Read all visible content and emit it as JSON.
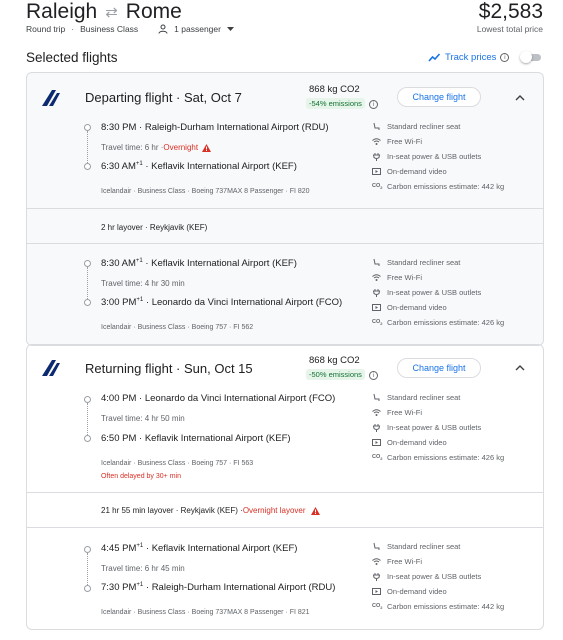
{
  "header": {
    "origin": "Raleigh",
    "destination": "Rome",
    "price": "$2,583",
    "price_sub": "Lowest total price",
    "trip_type": "Round trip",
    "cabin": "Business Class",
    "passengers": "1 passenger"
  },
  "selected_label": "Selected flights",
  "track_label": "Track prices",
  "departing": {
    "title": "Departing flight · Sat, Oct 7",
    "co2": "868 kg CO2",
    "emissions": "-54% emissions",
    "change": "Change flight",
    "leg1": {
      "dep_time": "8:30 PM",
      "dep_airport": "Raleigh-Durham International Airport (RDU)",
      "travel": "Travel time: 6 hr · ",
      "overnight": "Overnight",
      "arr_time": "6:30 AM",
      "arr_plus": "+1",
      "arr_airport": "Keflavik International Airport (KEF)",
      "details": "Icelandair · Business Class · Boeing 737MAX 8 Passenger · FI 820",
      "amenities": [
        "Standard recliner seat",
        "Free Wi-Fi",
        "In-seat power & USB outlets",
        "On-demand video",
        "Carbon emissions estimate: 442 kg"
      ]
    },
    "layover": "2 hr layover · Reykjavik (KEF)",
    "leg2": {
      "dep_time": "8:30 AM",
      "dep_plus": "+1",
      "dep_airport": "Keflavik International Airport (KEF)",
      "travel": "Travel time: 4 hr 30 min",
      "arr_time": "3:00 PM",
      "arr_plus": "+1",
      "arr_airport": "Leonardo da Vinci International Airport (FCO)",
      "details": "Icelandair · Business Class · Boeing 757 · FI 562",
      "amenities": [
        "Standard recliner seat",
        "Free Wi-Fi",
        "In-seat power & USB outlets",
        "On-demand video",
        "Carbon emissions estimate: 426 kg"
      ]
    }
  },
  "returning": {
    "title": "Returning flight · Sun, Oct 15",
    "co2": "868 kg CO2",
    "emissions": "-50% emissions",
    "change": "Change flight",
    "leg1": {
      "dep_time": "4:00 PM",
      "dep_airport": "Leonardo da Vinci International Airport (FCO)",
      "travel": "Travel time: 4 hr 50 min",
      "arr_time": "6:50 PM",
      "arr_airport": "Keflavik International Airport (KEF)",
      "details": "Icelandair · Business Class · Boeing 757 · FI 563",
      "delay": "Often delayed by 30+ min",
      "amenities": [
        "Standard recliner seat",
        "Free Wi-Fi",
        "In-seat power & USB outlets",
        "On-demand video",
        "Carbon emissions estimate: 426 kg"
      ]
    },
    "layover": "21 hr 55 min layover · Reykjavik (KEF) · ",
    "layover_overnight": "Overnight layover",
    "leg2": {
      "dep_time": "4:45 PM",
      "dep_plus": "+1",
      "dep_airport": "Keflavik International Airport (KEF)",
      "travel": "Travel time: 6 hr 45 min",
      "arr_time": "7:30 PM",
      "arr_plus": "+1",
      "arr_airport": "Raleigh-Durham International Airport (RDU)",
      "details": "Icelandair · Business Class · Boeing 737MAX 8 Passenger · FI 821",
      "amenities": [
        "Standard recliner seat",
        "Free Wi-Fi",
        "In-seat power & USB outlets",
        "On-demand video",
        "Carbon emissions estimate: 442 kg"
      ]
    }
  },
  "icons": {
    "amenity_icons": [
      "seat-icon",
      "wifi-icon",
      "power-icon",
      "video-icon",
      "co2-icon"
    ],
    "warning": "warning-icon",
    "airline_logo": "icelandair-logo"
  },
  "colors": {
    "accent": "#1a73e8",
    "warning": "#d93025",
    "emissions_green": "#137333",
    "airline_blue": "#0b2a6f"
  }
}
